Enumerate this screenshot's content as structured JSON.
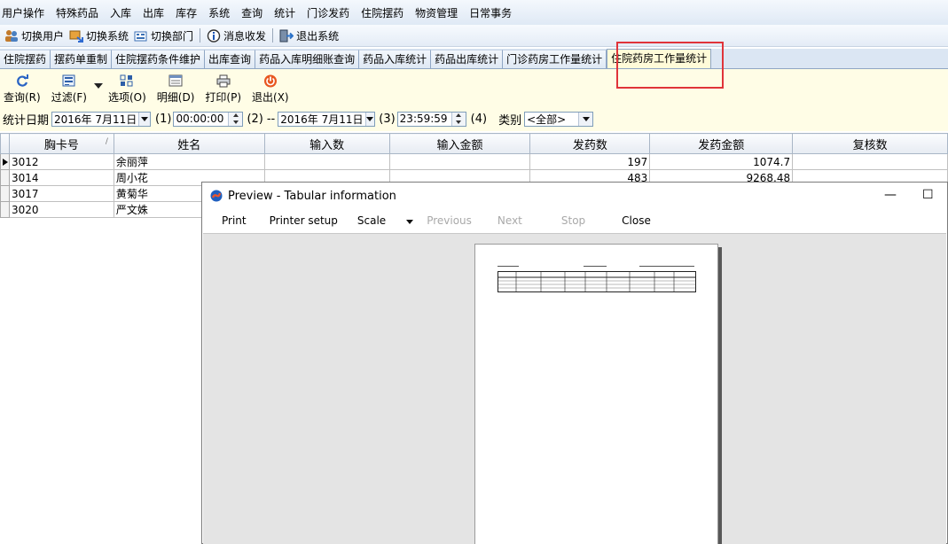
{
  "menubar": {
    "items": [
      "用户操作",
      "特殊药品",
      "入库",
      "出库",
      "库存",
      "系统",
      "查询",
      "统计",
      "门诊发药",
      "住院摆药",
      "物资管理",
      "日常事务"
    ]
  },
  "toolbar": {
    "switch_user": "切换用户",
    "switch_system": "切换系统",
    "switch_dept": "切换部门",
    "messages": "消息收发",
    "exit_system": "退出系统"
  },
  "tabs": {
    "items": [
      "住院摆药",
      "摆药单重制",
      "住院摆药条件维护",
      "出库查询",
      "药品入库明细账查询",
      "药品入库统计",
      "药品出库统计",
      "门诊药房工作量统计",
      "住院药房工作量统计"
    ],
    "active_index": 8
  },
  "actions": {
    "query": "查询(R)",
    "filter": "过滤(F)",
    "options": "选项(O)",
    "detail": "明细(D)",
    "print": "打印(P)",
    "exit": "退出(X)"
  },
  "filters": {
    "date_label": "统计日期",
    "start_date": "2016年  7月11日",
    "marker1": "(1)",
    "start_time": "00:00:00",
    "marker2": "(2)",
    "dash": "--",
    "end_date": "2016年  7月11日",
    "marker3": "(3)",
    "end_time": "23:59:59",
    "marker4": "(4)",
    "category_label": "类别",
    "category_value": "<全部>"
  },
  "grid": {
    "columns": [
      "胸卡号",
      "姓名",
      "输入数",
      "输入金额",
      "发药数",
      "发药金额",
      "复核数"
    ],
    "rows": [
      {
        "card": "3012",
        "name": "余丽萍",
        "input_count": "",
        "input_amount": "",
        "dispense_count": "197",
        "dispense_amount": "1074.7",
        "review_count": ""
      },
      {
        "card": "3014",
        "name": "周小花",
        "input_count": "",
        "input_amount": "",
        "dispense_count": "483",
        "dispense_amount": "9268.48",
        "review_count": ""
      },
      {
        "card": "3017",
        "name": "黄菊华",
        "input_count": "",
        "input_amount": "",
        "dispense_count": "",
        "dispense_amount": "",
        "review_count": ""
      },
      {
        "card": "3020",
        "name": "严文姝",
        "input_count": "",
        "input_amount": "",
        "dispense_count": "",
        "dispense_amount": "",
        "review_count": ""
      }
    ]
  },
  "preview": {
    "title": "Preview - Tabular information",
    "print": "Print",
    "printer_setup": "Printer setup",
    "scale": "Scale",
    "previous": "Previous",
    "next": "Next",
    "stop": "Stop",
    "close": "Close",
    "minimize_glyph": "—",
    "maximize_glyph": "☐"
  },
  "colors": {
    "highlight_box": "#e0343a",
    "panel_bg": "#fffde6",
    "active_tab_bg": "#fffbd9"
  }
}
